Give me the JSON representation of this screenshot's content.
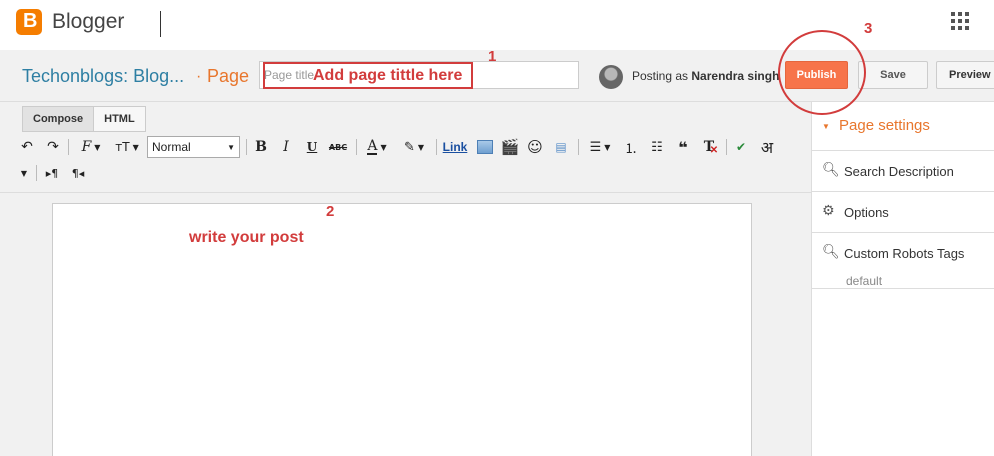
{
  "header": {
    "app_name": "Blogger",
    "logo_letter": "B"
  },
  "titlebar": {
    "blog_name": "Techonblogs: Blog...",
    "separator": "·",
    "page_type": "Page",
    "title_placeholder": "Page title",
    "posting_as_prefix": "Posting as",
    "posting_as_user": "Narendra singh",
    "publish_label": "Publish",
    "save_label": "Save",
    "preview_label": "Preview"
  },
  "editor": {
    "tabs": [
      {
        "label": "Compose",
        "active": true
      },
      {
        "label": "HTML",
        "active": false
      }
    ],
    "font_size_value": "Normal",
    "link_label": "Link",
    "toolbar_icons": [
      "undo-icon",
      "redo-icon",
      "font-family-icon",
      "font-size-icon",
      "bold-icon",
      "italic-icon",
      "underline-icon",
      "strikethrough-icon",
      "text-color-icon",
      "highlight-icon",
      "link",
      "image-icon",
      "video-icon",
      "emoji-icon",
      "jump-break-icon",
      "align-icon",
      "numbered-list-icon",
      "bulleted-list-icon",
      "quote-icon",
      "clear-format-icon",
      "spellcheck-icon",
      "transliterate-icon",
      "ltr-icon",
      "rtl-icon"
    ]
  },
  "sidebar": {
    "title": "Page settings",
    "items": [
      {
        "label": "Search Description",
        "icon": "search-icon",
        "sub": ""
      },
      {
        "label": "Options",
        "icon": "gear-icon",
        "sub": ""
      },
      {
        "label": "Custom Robots Tags",
        "icon": "search-icon",
        "sub": "default"
      }
    ]
  },
  "annotations": {
    "title_hint": "Add page tittle here",
    "post_hint": "write your post",
    "num1": "1",
    "num2": "2",
    "num3": "3"
  },
  "colors": {
    "accent_orange": "#e8762d",
    "publish_bg": "#f7744a",
    "blog_link": "#2e7fa3",
    "annotation_red": "#d23c3c"
  }
}
